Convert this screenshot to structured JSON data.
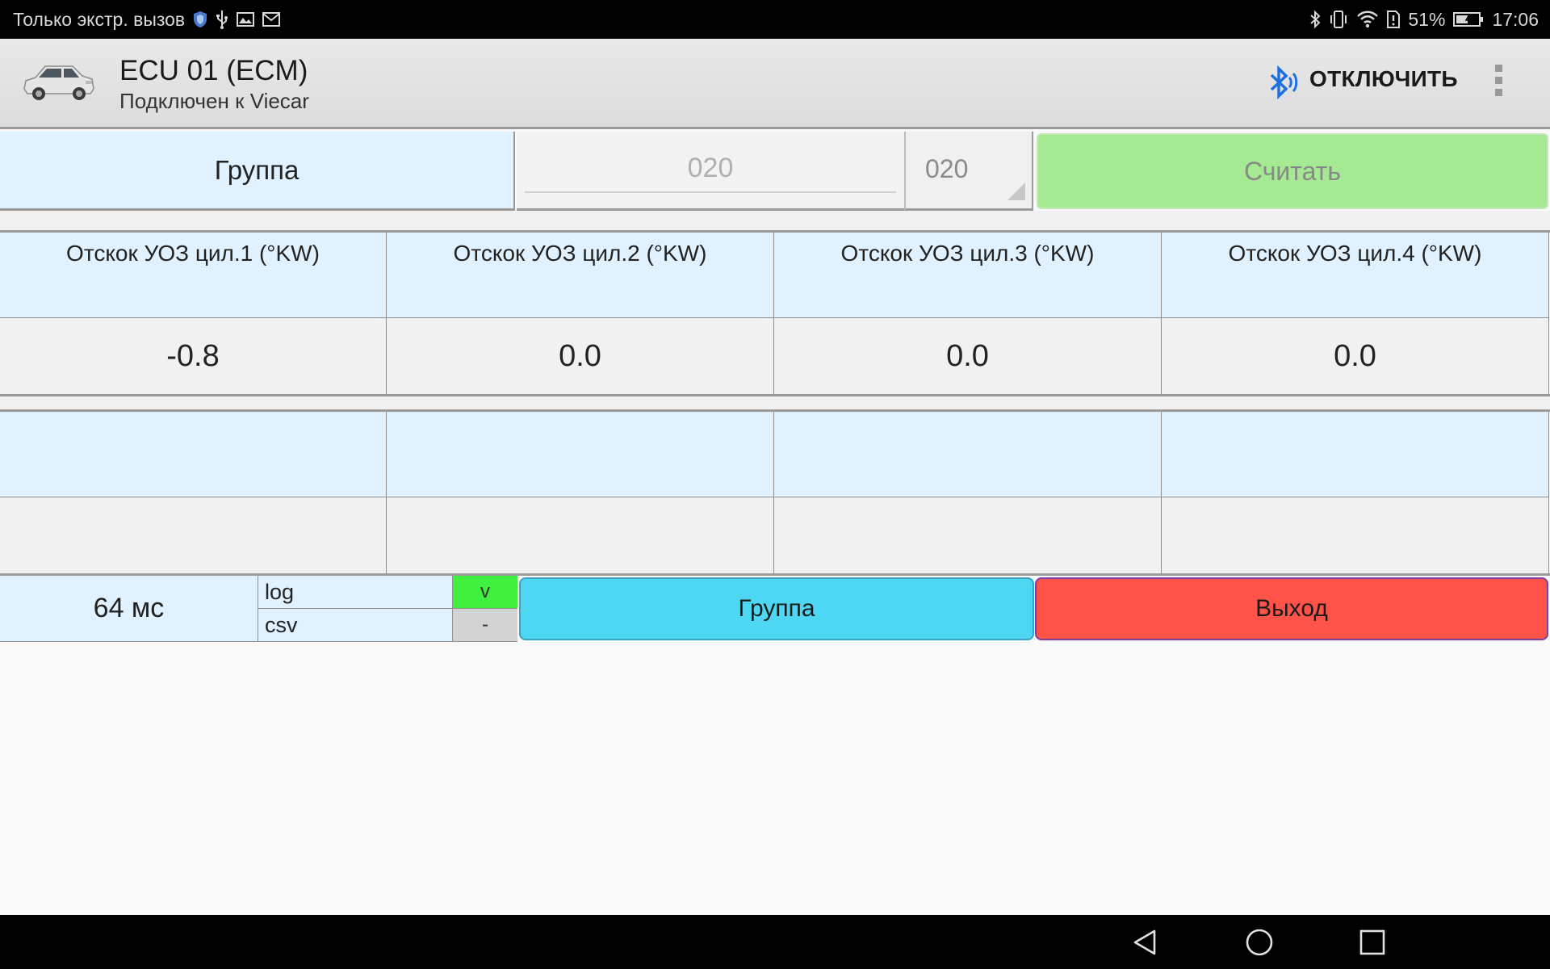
{
  "status_bar": {
    "carrier": "Только экстр. вызов",
    "battery": "51%",
    "time": "17:06",
    "icons_left": [
      "shield-icon",
      "usb-icon",
      "image-icon",
      "mail-icon"
    ],
    "icons_right": [
      "bluetooth-icon",
      "vibrate-icon",
      "wifi-icon",
      "sim-alert-icon",
      "battery-icon"
    ]
  },
  "app_bar": {
    "title": "ECU 01 (ECM)",
    "subtitle": "Подключен к Viecar",
    "disconnect_label": "ОТКЛЮЧИТЬ",
    "bluetooth_color": "#1e6fe0"
  },
  "top_row": {
    "group_label": "Группа",
    "group_input_value": "020",
    "group_select_value": "020",
    "read_button": "Считать",
    "read_button_color": "#a5e992"
  },
  "measurements": {
    "headers": [
      "Отскок УОЗ цил.1 (°KW)",
      "Отскок УОЗ цил.2 (°KW)",
      "Отскок УОЗ цил.3 (°KW)",
      "Отскок УОЗ цил.4 (°KW)"
    ],
    "values": [
      "-0.8",
      "0.0",
      "0.0",
      "0.0"
    ],
    "headers_2": [
      "",
      "",
      "",
      ""
    ],
    "values_2": [
      "",
      "",
      "",
      ""
    ]
  },
  "bottom": {
    "rate": "64 мс",
    "log_label": "log",
    "log_toggle": "v",
    "log_toggle_color": "#3ff03f",
    "csv_label": "csv",
    "csv_toggle": "-",
    "csv_toggle_color": "#d3d3d3",
    "group_button": "Группа",
    "group_button_color": "#4dd7f2",
    "exit_button": "Выход",
    "exit_button_color": "#ff5248"
  },
  "nav_bar": {
    "buttons": [
      "back-icon",
      "home-icon",
      "recents-icon"
    ]
  }
}
